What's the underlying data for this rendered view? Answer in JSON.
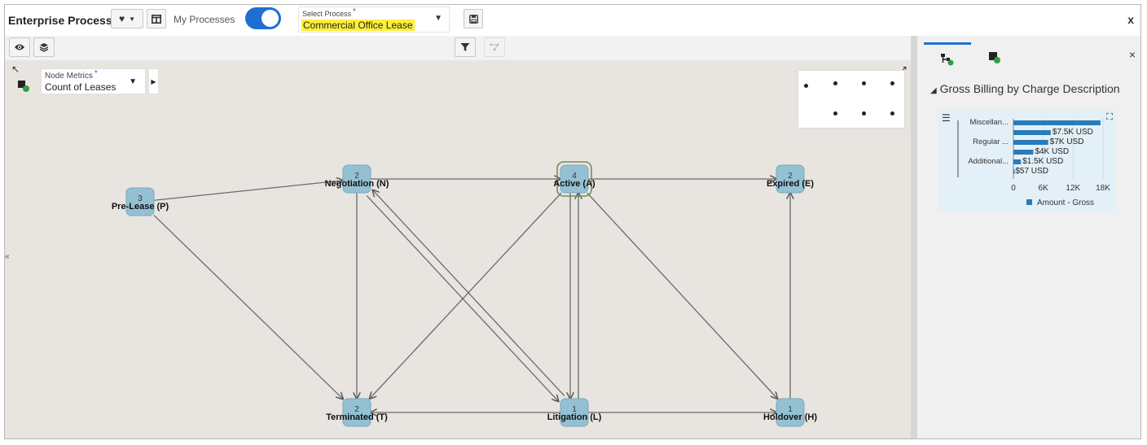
{
  "header": {
    "title": "Enterprise Process",
    "my_processes_label": "My Processes",
    "select_process_label": "Select Process",
    "required_mark": "*",
    "select_process_value": "Commercial Office Lease",
    "close_label": "x"
  },
  "metrics": {
    "label": "Node Metrics",
    "required_mark": "*",
    "value": "Count of Leases"
  },
  "graph": {
    "nodes": [
      {
        "id": "P",
        "label": "Pre-Lease (P)",
        "count": "3"
      },
      {
        "id": "N",
        "label": "Negotiation (N)",
        "count": "2"
      },
      {
        "id": "A",
        "label": "Active (A)",
        "count": "4"
      },
      {
        "id": "E",
        "label": "Expired (E)",
        "count": "2"
      },
      {
        "id": "T",
        "label": "Terminated (T)",
        "count": "2"
      },
      {
        "id": "L",
        "label": "Litigation (L)",
        "count": "1"
      },
      {
        "id": "H",
        "label": "Holdover (H)",
        "count": "1"
      }
    ],
    "edges": [
      [
        "P",
        "N"
      ],
      [
        "P",
        "T"
      ],
      [
        "N",
        "A"
      ],
      [
        "N",
        "T"
      ],
      [
        "N",
        "L"
      ],
      [
        "L",
        "N"
      ],
      [
        "A",
        "E"
      ],
      [
        "A",
        "T"
      ],
      [
        "A",
        "L"
      ],
      [
        "L",
        "A"
      ],
      [
        "A",
        "H"
      ],
      [
        "L",
        "T"
      ],
      [
        "L",
        "H"
      ],
      [
        "H",
        "E"
      ]
    ]
  },
  "right_panel": {
    "close_label": "×",
    "chart_title": "Gross Billing by Charge Description"
  },
  "chart_data": {
    "type": "bar",
    "orientation": "horizontal",
    "title": "Gross Billing by Charge Description",
    "categories_shown": [
      "Miscellan...",
      "Regular ...",
      "Additional..."
    ],
    "data_labels": [
      "$7.5K USD",
      "$7K USD",
      "$4K USD",
      "$1.5K USD",
      "$57 USD"
    ],
    "values": [
      17500,
      7500,
      7000,
      4000,
      1500,
      57
    ],
    "x_ticks": [
      "0",
      "6K",
      "12K",
      "18K"
    ],
    "xlim": [
      0,
      18000
    ],
    "legend": [
      "Amount - Gross"
    ],
    "series_color": "#2b7bb9"
  }
}
